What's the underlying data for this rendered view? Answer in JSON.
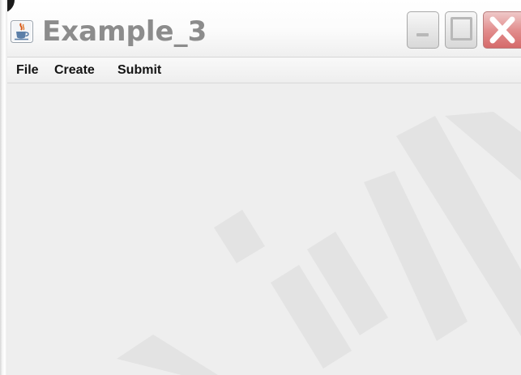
{
  "window": {
    "title": "Example_3",
    "app_icon": "java-coffee-cup-icon",
    "controls": {
      "minimize": "minimize-icon",
      "maximize": "maximize-icon",
      "close": "close-icon"
    },
    "colors": {
      "title_text": "#8c8c8c",
      "close_button": "#d56a6a",
      "content_background": "#eeeeee"
    }
  },
  "menubar": {
    "items": [
      {
        "label": "File"
      },
      {
        "label": "Create"
      },
      {
        "label": "Submit"
      }
    ]
  }
}
